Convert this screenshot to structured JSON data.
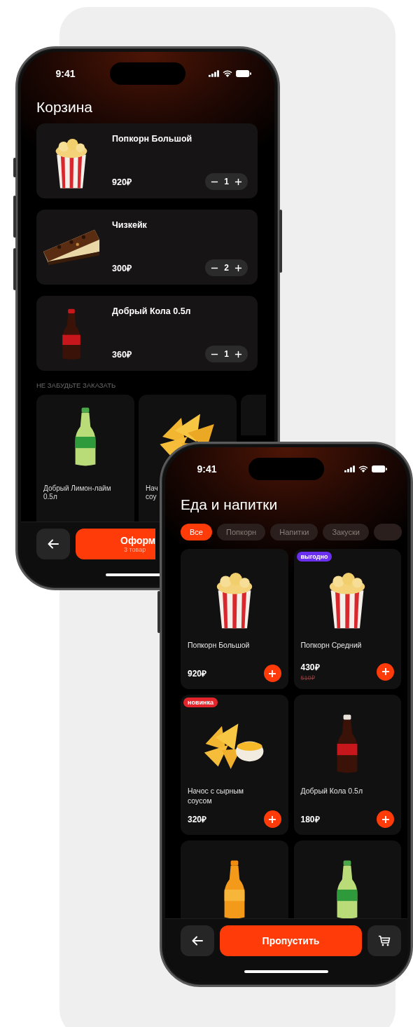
{
  "cart_screen": {
    "status_bar": {
      "time": "9:41"
    },
    "title": "Корзина",
    "cart_items": [
      {
        "name": "Попкорн Большой",
        "price": "920₽",
        "quantity": "1"
      },
      {
        "name": "Чизкейк",
        "price": "300₽",
        "quantity": "2"
      },
      {
        "name": "Добрый Кола 0.5л",
        "price": "360₽",
        "quantity": "1"
      }
    ],
    "section_label": "НЕ ЗАБУДЬТЕ ЗАКАЗАТЬ",
    "recommendations": [
      {
        "lines": [
          "Добрый Лимон-лайм",
          "0.5л"
        ]
      },
      {
        "lines": [
          "Нач",
          "соу"
        ]
      }
    ],
    "checkout_button": {
      "label": "Оформ",
      "sublabel": "3 товар"
    }
  },
  "food_screen": {
    "status_bar": {
      "time": "9:41"
    },
    "title": "Еда и напитки",
    "categories": [
      {
        "label": "Все",
        "selected": true
      },
      {
        "label": "Попкорн",
        "selected": false
      },
      {
        "label": "Напитки",
        "selected": false
      },
      {
        "label": "Закуски",
        "selected": false
      }
    ],
    "products": [
      {
        "name": "Попкорн Большой",
        "price": "920₽"
      },
      {
        "name": "Попкорн Средний",
        "price": "430₽",
        "old_price": "510₽",
        "badge": {
          "text": "выгодно",
          "color": "#6b2ff0"
        }
      },
      {
        "name": "Начос с сырным соусом",
        "price": "320₽",
        "badge": {
          "text": "новинка",
          "color": "#e3242b"
        }
      },
      {
        "name": "Добрый Кола 0.5л",
        "price": "180₽"
      },
      {
        "kind": "picture"
      },
      {
        "kind": "picture"
      }
    ],
    "skip_button": {
      "label": "Пропустить"
    }
  }
}
